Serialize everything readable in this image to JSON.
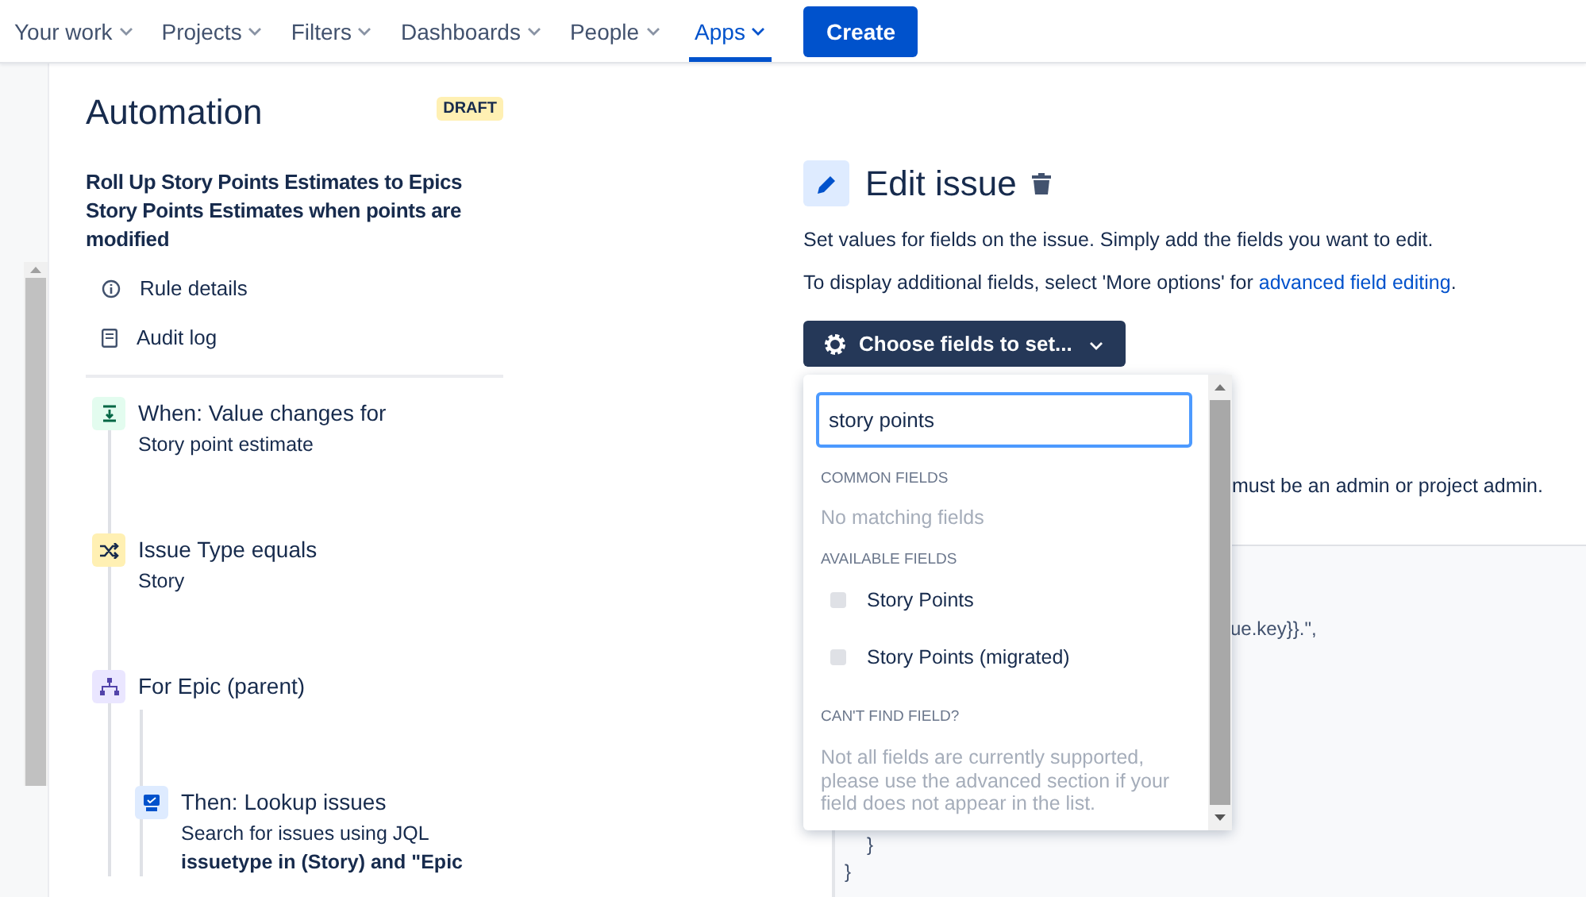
{
  "nav": {
    "items": [
      {
        "label": "Your work",
        "selected": false
      },
      {
        "label": "Projects",
        "selected": false
      },
      {
        "label": "Filters",
        "selected": false
      },
      {
        "label": "Dashboards",
        "selected": false
      },
      {
        "label": "People",
        "selected": false
      },
      {
        "label": "Apps",
        "selected": true
      }
    ],
    "create": "Create"
  },
  "rule_panel": {
    "title": "Automation",
    "badge": "DRAFT",
    "rule_name": "Roll Up Story Points Estimates to Epics Story Points Estimates when points are modified",
    "menu": [
      {
        "label": "Rule details",
        "kind": "info"
      },
      {
        "label": "Audit log",
        "kind": "log"
      }
    ],
    "steps": [
      {
        "kind": "trigger",
        "title": "When: Value changes for",
        "detail": "Story point estimate"
      },
      {
        "kind": "condition",
        "title": "Issue Type equals",
        "detail": "Story"
      },
      {
        "kind": "branch",
        "title": "For Epic (parent)",
        "children": [
          {
            "kind": "lookup",
            "title": "Then: Lookup issues",
            "detail": "Search for issues using JQL",
            "query": "issuetype in (Story) and \"Epic"
          }
        ]
      }
    ]
  },
  "editor": {
    "title": "Edit issue",
    "description": "Set values for fields on the issue. Simply add the fields you want to edit.",
    "hint": "To display additional fields, select 'More options' for ",
    "hint_link": "advanced field editing",
    "hint_end": ".",
    "button": "Choose fields to set...",
    "notice": "must be an admin or project admin.",
    "code_lines": [
      {
        "text": "ue.key}}.\",",
        "kind": "tail"
      },
      {
        "text": "}",
        "kind": "indent2"
      },
      {
        "text": "}",
        "kind": "indent1"
      }
    ]
  },
  "dropdown": {
    "search": "story points",
    "sections": [
      {
        "heading": "COMMON FIELDS",
        "empty": "No matching fields"
      },
      {
        "heading": "AVAILABLE FIELDS",
        "items": [
          {
            "label": "Story Points",
            "checked": false
          },
          {
            "label": "Story Points (migrated)",
            "checked": false
          }
        ]
      },
      {
        "heading": "CAN'T FIND FIELD?",
        "message": "Not all fields are currently supported, please use the advanced section if your field does not appear in the list."
      }
    ]
  }
}
